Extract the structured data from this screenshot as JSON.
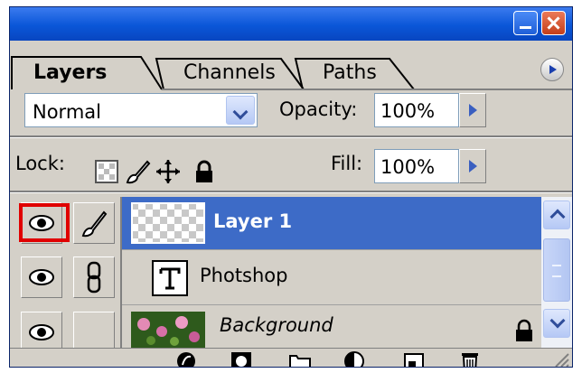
{
  "window": {
    "minimize_icon": "minimize-icon",
    "close_icon": "close-icon"
  },
  "tabs": [
    {
      "label": "Layers",
      "active": true
    },
    {
      "label": "Channels",
      "active": false
    },
    {
      "label": "Paths",
      "active": false
    }
  ],
  "blend_mode": {
    "value": "Normal"
  },
  "opacity": {
    "label": "Opacity:",
    "value": "100%"
  },
  "lock": {
    "label": "Lock:",
    "icons": [
      "lock-transparent-icon",
      "lock-image-icon",
      "lock-position-icon",
      "lock-all-icon"
    ]
  },
  "fill": {
    "label": "Fill:",
    "value": "100%"
  },
  "layers": [
    {
      "name": "Layer 1",
      "selected": true,
      "visible": true,
      "thumb": "transparent"
    },
    {
      "name": "Photshop",
      "selected": false,
      "visible": true,
      "thumb": "text-layer-icon"
    },
    {
      "name": "Background",
      "selected": false,
      "visible": true,
      "thumb": "flowers",
      "locked": true
    }
  ],
  "bottom_icons": [
    "layer-style-icon",
    "layer-mask-icon",
    "new-set-icon",
    "adjustment-layer-icon",
    "new-layer-icon",
    "trash-icon"
  ],
  "colors": {
    "titlebar": "#0a56d8",
    "selection": "#3d6bc7",
    "highlight_box": "#e00000",
    "panel": "#d4d0c8"
  }
}
